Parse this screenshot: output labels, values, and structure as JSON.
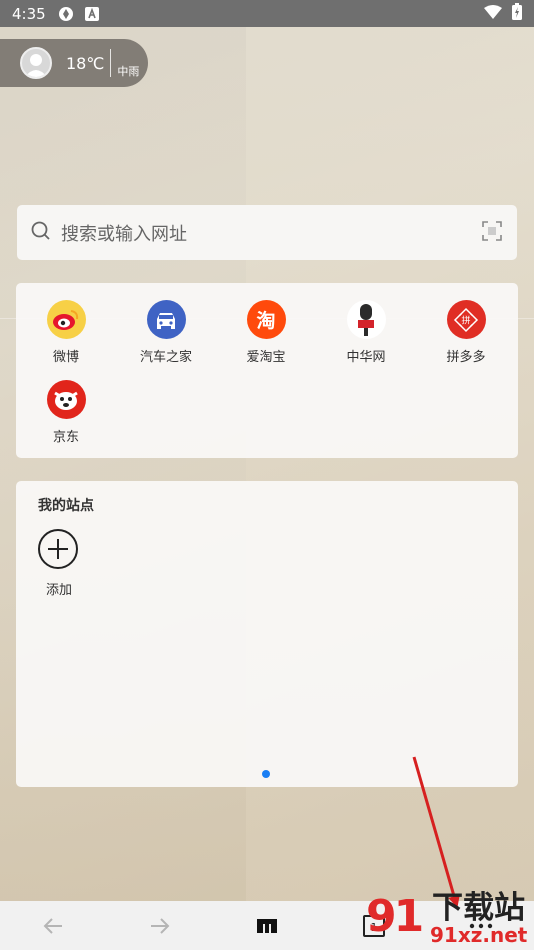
{
  "status_bar": {
    "time": "4:35"
  },
  "weather": {
    "temperature": "18℃",
    "condition": "中雨"
  },
  "search": {
    "placeholder": "搜索或输入网址"
  },
  "shortcuts": [
    {
      "label": "微博",
      "color": "#f7d046"
    },
    {
      "label": "汽车之家",
      "color": "#3f63c4"
    },
    {
      "label": "爱淘宝",
      "color": "#ff4a0c",
      "glyph": "淘"
    },
    {
      "label": "中华网",
      "color": "#ffffff"
    },
    {
      "label": "拼多多",
      "color": "#e02e24",
      "glyph": "拼"
    },
    {
      "label": "京东",
      "color": "#e1251b"
    }
  ],
  "my_sites": {
    "title": "我的站点",
    "add_label": "添加"
  },
  "toolbar": {
    "back_icon": "arrow-left-icon",
    "forward_icon": "arrow-right-icon",
    "home_icon": "home-icon",
    "tabs_icon": "tabs-icon",
    "menu_icon": "more-menu-icon",
    "tabs_count": "1"
  },
  "watermark": {
    "brand_num": "91",
    "brand_cn": "下载站",
    "url": "91xz.net"
  },
  "colors": {
    "accent": "#1a7ef3",
    "annotation_arrow": "#d62020"
  }
}
